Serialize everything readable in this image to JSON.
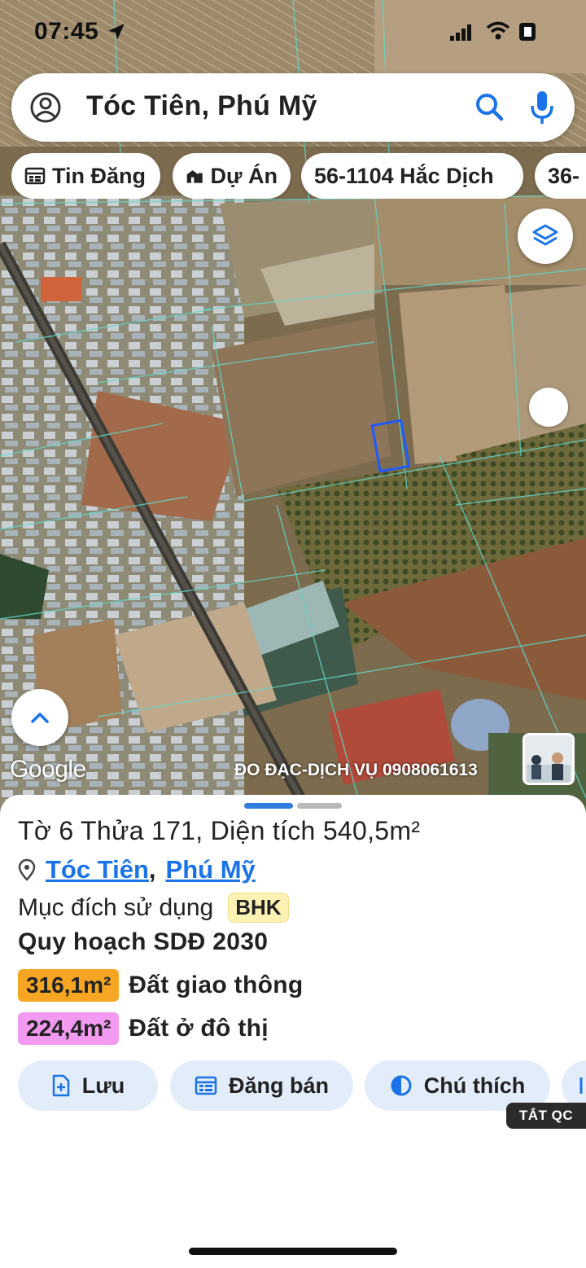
{
  "status_bar": {
    "time": "07:45"
  },
  "search": {
    "text": "Tóc Tiên, Phú Mỹ"
  },
  "chips": [
    {
      "label": "Tin Đăng",
      "icon": "calendar-icon"
    },
    {
      "label": "Dự Án",
      "icon": "building-icon"
    },
    {
      "label": "56-1104 Hắc Dịch",
      "icon": ""
    },
    {
      "label": "36-",
      "icon": ""
    }
  ],
  "map": {
    "google_label": "Google",
    "watermark": "ĐO ĐẠC-DỊCH VỤ 0908061613",
    "highlight_color": "#1e5bff"
  },
  "sheet": {
    "title": "Tờ 6 Thửa 171, Diện tích 540,5m²",
    "location": {
      "commune": "Tóc Tiên",
      "separator": ",",
      "district": "Phú Mỹ"
    },
    "purpose_label": "Mục đích sử dụng",
    "purpose_code": "BHK",
    "plan_title": "Quy hoạch SDĐ 2030",
    "zones": [
      {
        "area": "316,1m²",
        "label": "Đất giao thông",
        "color": "#f6a623"
      },
      {
        "area": "224,4m²",
        "label": "Đất ở đô thị",
        "color": "#f29af0"
      }
    ],
    "actions": [
      {
        "label": "Lưu",
        "icon": "file-add-icon"
      },
      {
        "label": "Đăng bán",
        "icon": "calendar-icon"
      },
      {
        "label": "Chú thích",
        "icon": "contrast-icon"
      },
      {
        "label": "",
        "icon": "share-icon"
      }
    ],
    "ad_toggle": "TẮT QC"
  }
}
